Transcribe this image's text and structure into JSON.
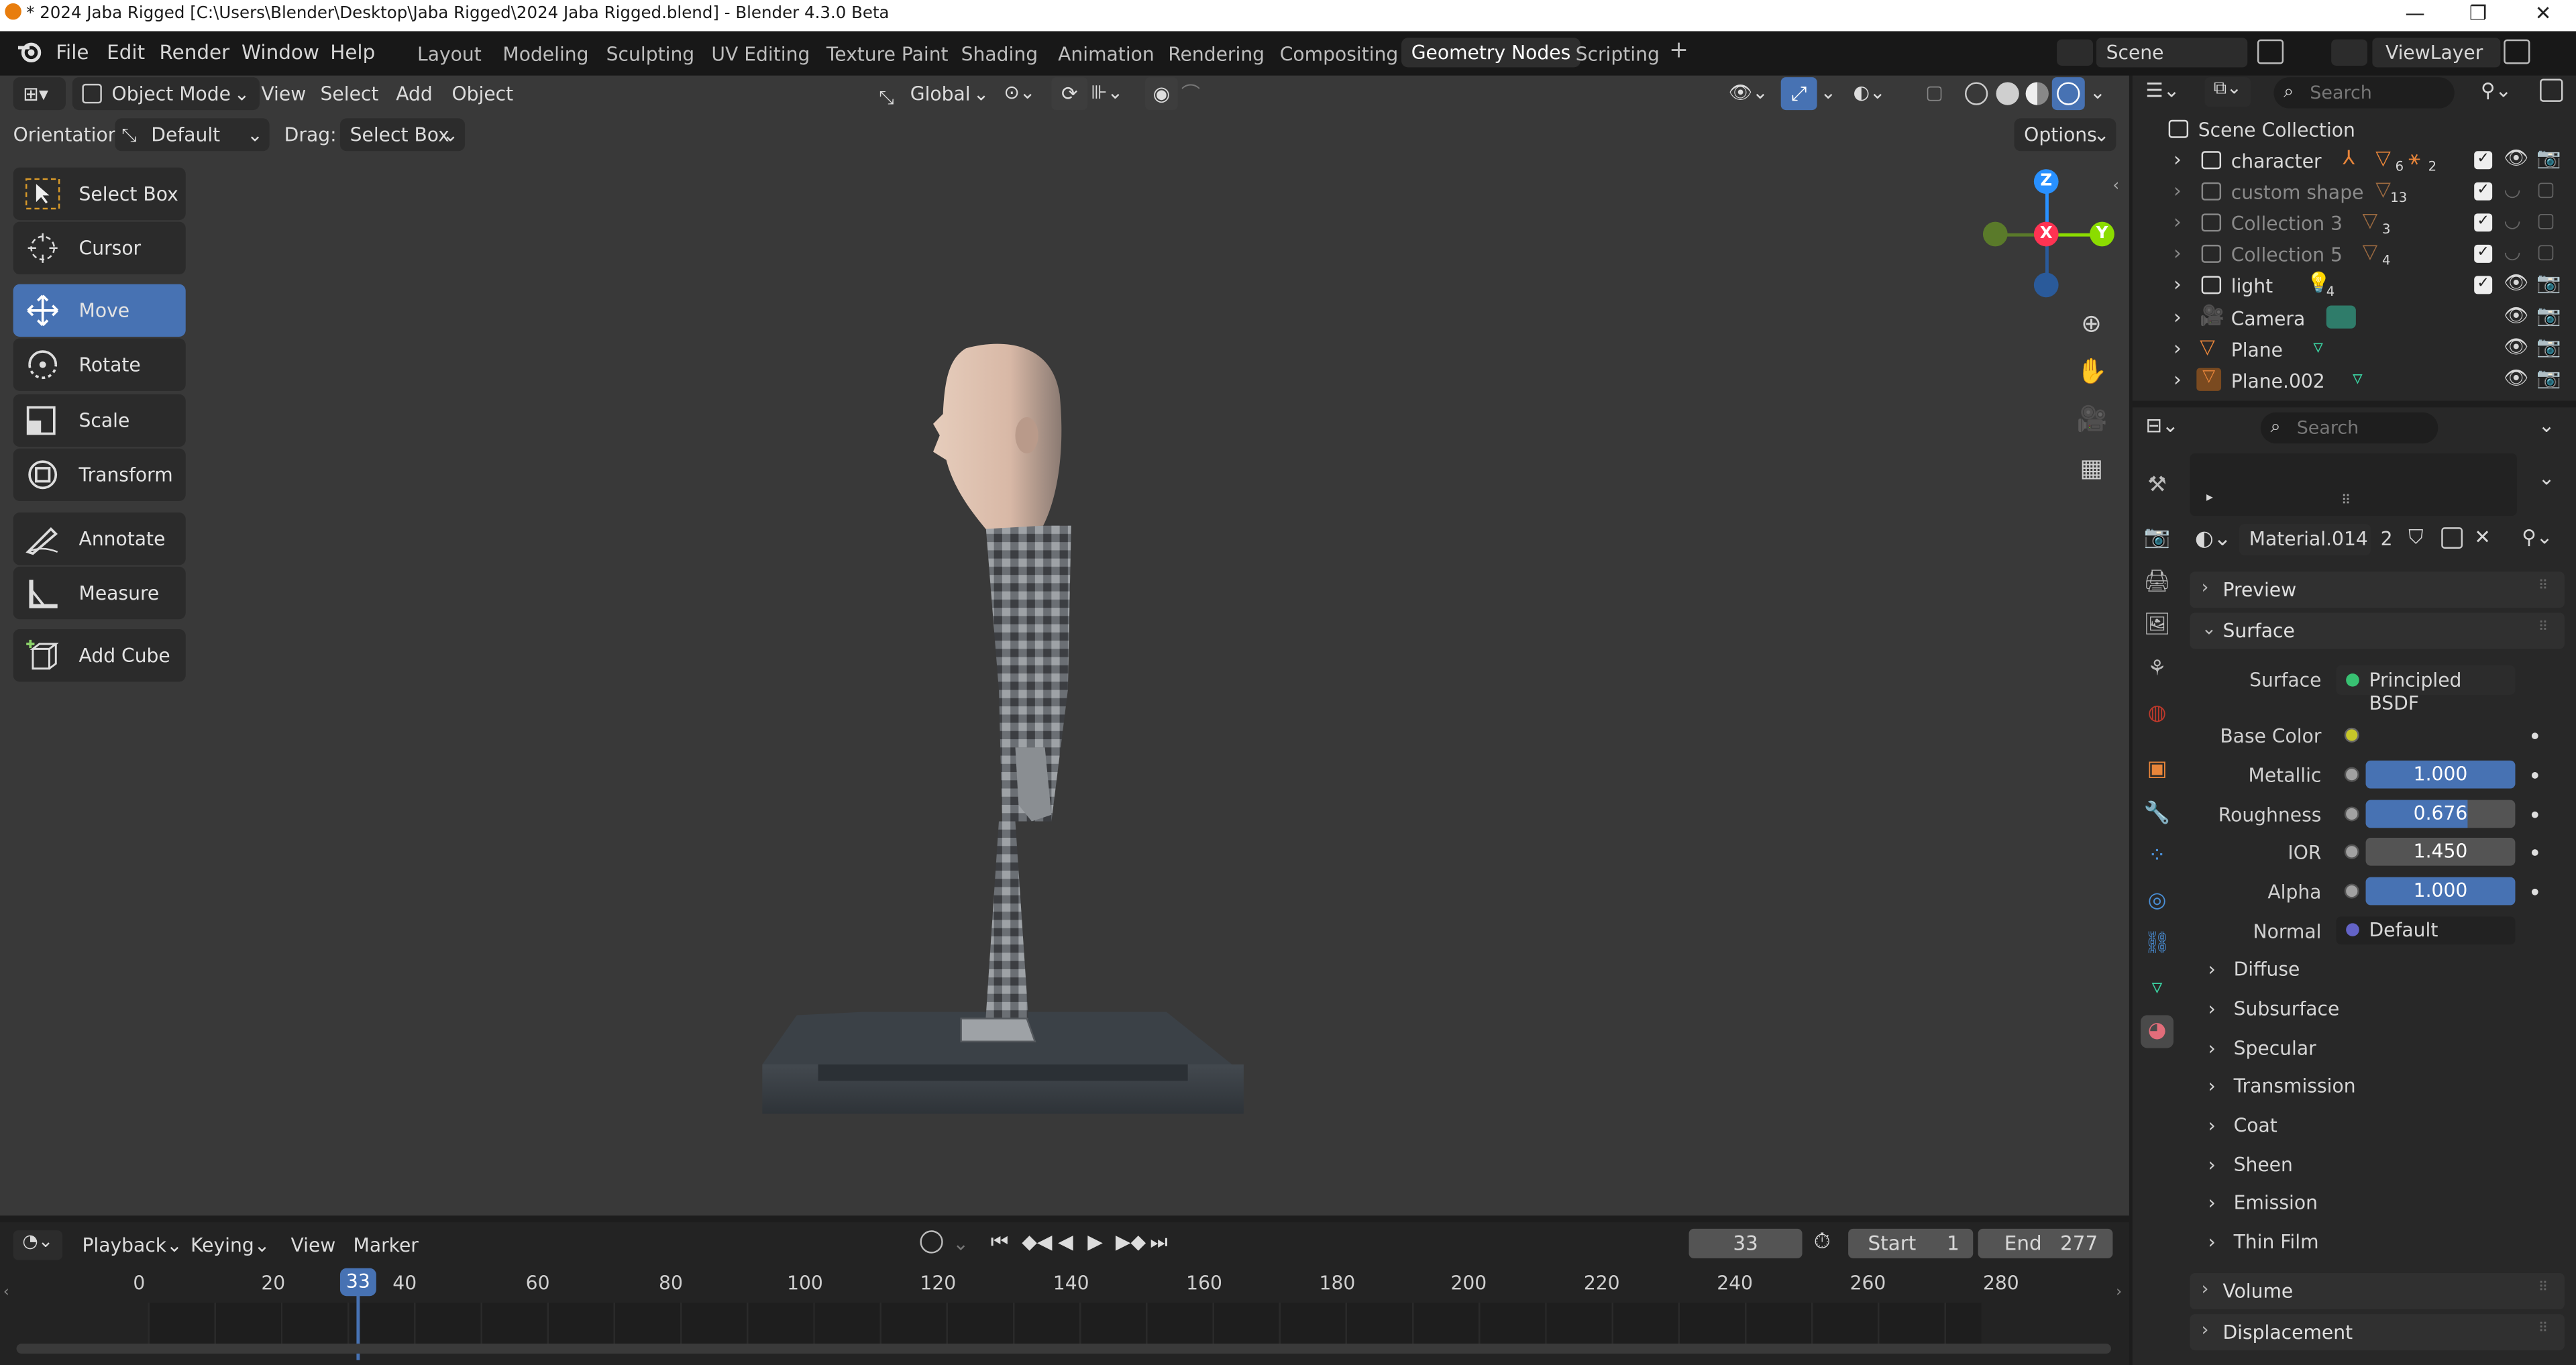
{
  "title": "* 2024 Jaba Rigged [C:\\Users\\Blender\\Desktop\\Jaba Rigged\\2024 Jaba Rigged.blend] - Blender 4.3.0 Beta",
  "window_controls": {
    "minimize": "—",
    "maximize": "❐",
    "close": "✕"
  },
  "menus": [
    "File",
    "Edit",
    "Render",
    "Window",
    "Help"
  ],
  "workspaces": [
    "Layout",
    "Modeling",
    "Sculpting",
    "UV Editing",
    "Texture Paint",
    "Shading",
    "Animation",
    "Rendering",
    "Compositing",
    "Geometry Nodes",
    "Scripting"
  ],
  "workspace_active": "Geometry Nodes",
  "add_workspace": "+",
  "scene_name": "Scene",
  "view_layer": "ViewLayer",
  "viewport_header": {
    "mode": "Object Mode",
    "menus": [
      "View",
      "Select",
      "Add",
      "Object"
    ],
    "transform_orientation": "Global"
  },
  "tool_settings": {
    "orientation_label": "Orientation:",
    "orientation_value": "Default",
    "drag_label": "Drag:",
    "drag_value": "Select Box",
    "options": "Options"
  },
  "tools": [
    {
      "label": "Select Box",
      "icon": "select-box-icon"
    },
    {
      "label": "Cursor",
      "icon": "cursor-icon"
    },
    {
      "label": "Move",
      "icon": "move-icon",
      "active": true
    },
    {
      "label": "Rotate",
      "icon": "rotate-icon"
    },
    {
      "label": "Scale",
      "icon": "scale-icon"
    },
    {
      "label": "Transform",
      "icon": "transform-icon"
    },
    {
      "label": "Annotate",
      "icon": "annotate-icon"
    },
    {
      "label": "Measure",
      "icon": "measure-icon"
    },
    {
      "label": "Add Cube",
      "icon": "add-cube-icon"
    }
  ],
  "gizmo": {
    "z": "Z",
    "x": "X",
    "y": "Y"
  },
  "outliner": {
    "search_placeholder": "Search",
    "root": "Scene Collection",
    "items": [
      {
        "name": "character",
        "dim": false,
        "badge1": "6",
        "badge2": "2"
      },
      {
        "name": "custom shape",
        "dim": true,
        "badge1": "13"
      },
      {
        "name": "Collection 3",
        "dim": true,
        "badge1": "3"
      },
      {
        "name": "Collection 5",
        "dim": true,
        "badge1": "4"
      },
      {
        "name": "light",
        "dim": false,
        "badge1": "4"
      },
      {
        "name": "Camera",
        "dim": false
      },
      {
        "name": "Plane",
        "dim": false
      },
      {
        "name": "Plane.002",
        "dim": false
      }
    ]
  },
  "properties": {
    "search_placeholder": "Search",
    "material_name": "Material.014",
    "material_users": "2",
    "preview_label": "Preview",
    "surface_section": "Surface",
    "surface_label": "Surface",
    "surface_value": "Principled BSDF",
    "rows": [
      {
        "label": "Base Color",
        "value": "",
        "type": "color"
      },
      {
        "label": "Metallic",
        "value": "1.000",
        "fill": 1.0
      },
      {
        "label": "Roughness",
        "value": "0.676",
        "fill": 0.676
      },
      {
        "label": "IOR",
        "value": "1.450",
        "fill": 0
      },
      {
        "label": "Alpha",
        "value": "1.000",
        "fill": 1.0
      },
      {
        "label": "Normal",
        "value": "Default",
        "type": "link"
      }
    ],
    "subsections": [
      "Diffuse",
      "Subsurface",
      "Specular",
      "Transmission",
      "Coat",
      "Sheen",
      "Emission",
      "Thin Film"
    ],
    "volume_label": "Volume",
    "displacement_label": "Displacement"
  },
  "timeline": {
    "menus": [
      "Playback",
      "Keying",
      "View",
      "Marker"
    ],
    "current_frame": "33",
    "start_label": "Start",
    "start": "1",
    "end_label": "End",
    "end": "277",
    "ticks": [
      "0",
      "20",
      "40",
      "60",
      "80",
      "100",
      "120",
      "140",
      "160",
      "180",
      "200",
      "220",
      "240",
      "260",
      "280"
    ]
  },
  "colors": {
    "accent": "#4772b3",
    "background": "#1d1d1d",
    "viewport": "#393939",
    "x_axis": "#ff3352",
    "y_axis": "#8bdc00",
    "z_axis": "#2890ff"
  }
}
